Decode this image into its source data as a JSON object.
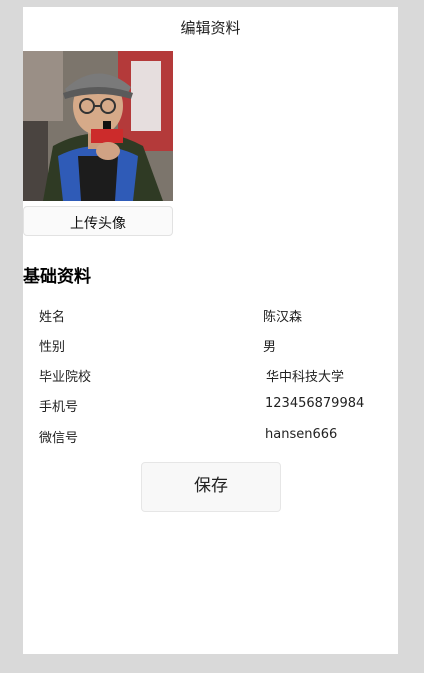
{
  "header": {
    "title": "编辑资料"
  },
  "avatar": {
    "upload_label": "上传头像"
  },
  "section": {
    "title": "基础资料"
  },
  "fields": [
    {
      "label": "姓名",
      "value": "陈汉森"
    },
    {
      "label": "性别",
      "value": "男"
    },
    {
      "label": "毕业院校",
      "value": "华中科技大学"
    },
    {
      "label": "手机号",
      "value": "123456879984"
    },
    {
      "label": "微信号",
      "value": "hansen666"
    }
  ],
  "actions": {
    "save_label": "保存"
  }
}
